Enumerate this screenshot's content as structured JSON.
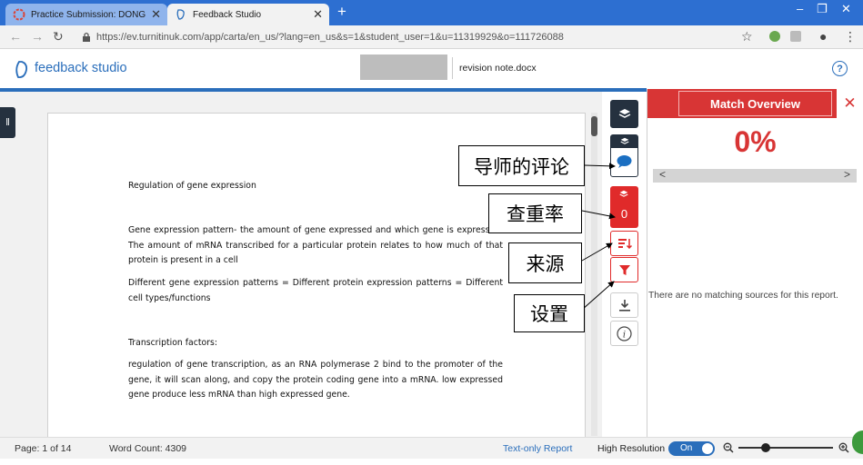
{
  "browser": {
    "tabs": [
      {
        "label": "Practice Submission: DONG, XUA"
      },
      {
        "label": "Feedback Studio"
      }
    ],
    "new_tab": "+",
    "url": "https://ev.turnitinuk.com/app/carta/en_us/?lang=en_us&s=1&student_user=1&u=11319929&o=111726088"
  },
  "header": {
    "brand": "feedback studio",
    "filename": "revision note.docx",
    "help": "?"
  },
  "document": {
    "heading": "Regulation of gene expression",
    "p1": "Gene expression pattern- the amount of gene expressed and which gene is expressed. The amount of mRNA transcribed for a particular protein relates to how much of that protein is present in a cell",
    "p2": "Different gene expression patterns = Different protein expression patterns = Different cell types/functions",
    "p3": "Transcription factors:",
    "p4": "regulation of gene transcription, as an RNA polymerase 2 bind to the promoter of the gene, it will scan along, and copy the protein coding gene into a mRNA. low expressed gene produce less mRNA than high expressed gene."
  },
  "tools": {
    "similarity_count": "0"
  },
  "callouts": {
    "comments": "导师的评论",
    "similarity": "查重率",
    "sources": "来源",
    "settings": "设置"
  },
  "panel": {
    "title": "Match Overview",
    "percent": "0%",
    "empty": "There are no matching sources for this report."
  },
  "footer": {
    "page": "Page: 1 of 14",
    "wordcount": "Word Count: 4309",
    "text_only": "Text-only Report",
    "hires_label": "High Resolution",
    "toggle": "On"
  },
  "colors": {
    "accent_blue": "#2a6ebb",
    "panel_red": "#d83535",
    "tab_blue": "#2d6fd1"
  }
}
